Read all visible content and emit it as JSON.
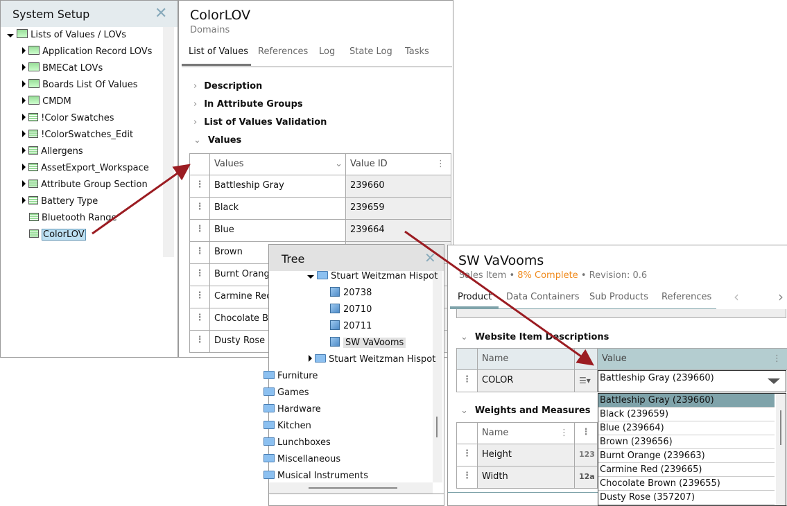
{
  "system_setup": {
    "title": "System Setup",
    "root": "Lists of Values / LOVs",
    "items": [
      {
        "label": "Application Record LOVs",
        "group": true,
        "expandable": true
      },
      {
        "label": "BMECat LOVs",
        "group": true,
        "expandable": true
      },
      {
        "label": "Boards List Of Values",
        "group": true,
        "expandable": true
      },
      {
        "label": "CMDM",
        "group": true,
        "expandable": true
      },
      {
        "label": "!Color Swatches",
        "group": false,
        "expandable": true
      },
      {
        "label": "!ColorSwatches_Edit",
        "group": false,
        "expandable": true
      },
      {
        "label": "Allergens",
        "group": false,
        "expandable": true
      },
      {
        "label": "AssetExport_Workspace",
        "group": false,
        "expandable": true
      },
      {
        "label": "Attribute Group Section",
        "group": false,
        "expandable": true
      },
      {
        "label": "Battery Type",
        "group": false,
        "expandable": true
      },
      {
        "label": "Bluetooth Range",
        "group": false,
        "expandable": false
      },
      {
        "label": "ColorLOV",
        "group": false,
        "expandable": false,
        "selected": true
      }
    ]
  },
  "colorlov": {
    "title": "ColorLOV",
    "subtitle": "Domains",
    "tabs": [
      "List of Values",
      "References",
      "Log",
      "State Log",
      "Tasks"
    ],
    "active_tab": "List of Values",
    "sections": [
      "Description",
      "In Attribute Groups",
      "List of Values Validation",
      "Values"
    ],
    "table": {
      "headers": [
        "Values",
        "Value ID"
      ],
      "rows": [
        [
          "Battleship Gray",
          "239660"
        ],
        [
          "Black",
          "239659"
        ],
        [
          "Blue",
          "239664"
        ],
        [
          "Brown",
          ""
        ],
        [
          "Burnt Orange",
          ""
        ],
        [
          "Carmine Red",
          ""
        ],
        [
          "Chocolate Br",
          ""
        ],
        [
          "Dusty Rose",
          ""
        ]
      ]
    }
  },
  "tree": {
    "title": "Tree",
    "nodes": [
      "Stuart Weitzman Hispot",
      "20738",
      "20710",
      "20711",
      "SW VaVooms",
      "Stuart Weitzman Hispot",
      "Furniture",
      "Games",
      "Hardware",
      "Kitchen",
      "Lunchboxes",
      "Miscellaneous",
      "Musical Instruments"
    ]
  },
  "product": {
    "title": "SW VaVooms",
    "type": "Sales Item",
    "complete": "8% Complete",
    "revision": "Revision: 0.6",
    "tabs": [
      "Product",
      "Data Containers",
      "Sub Products",
      "References"
    ],
    "active_tab": "Product",
    "section1": "Website Item Descriptions",
    "section2": "Weights and Measures",
    "col_name": "Name",
    "col_value": "Value",
    "color_row": {
      "name": "COLOR",
      "value": "Battleship Gray (239660)"
    },
    "measure_rows": [
      {
        "name": "Height",
        "icon": "123"
      },
      {
        "name": "Width",
        "icon": "12a"
      }
    ],
    "dropdown": [
      "Battleship Gray (239660)",
      "Black (239659)",
      "Blue (239664)",
      "Brown (239656)",
      "Burnt Orange (239663)",
      "Carmine Red (239665)",
      "Chocolate Brown (239655)",
      "Dusty Rose (357207)"
    ]
  },
  "colors": {
    "accent": "#7fa3aa",
    "arrow": "#9b1c22",
    "complete": "#f08a1c",
    "header_bg": "#e4ebee"
  }
}
